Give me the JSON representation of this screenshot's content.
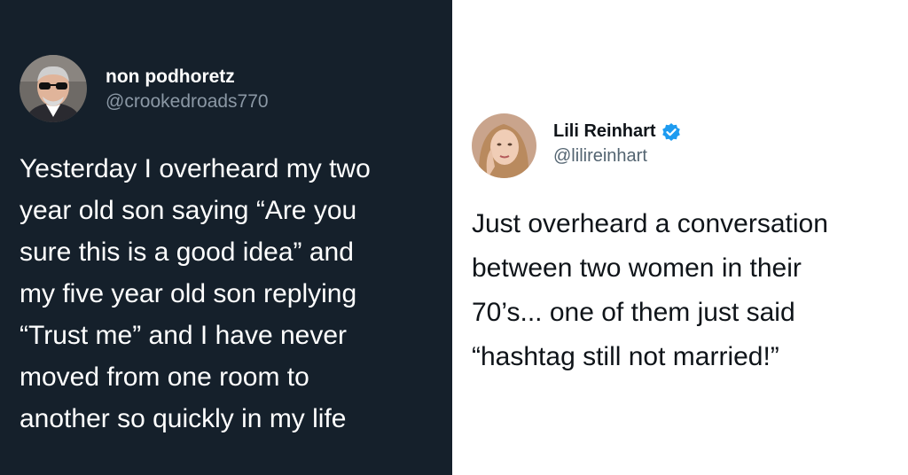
{
  "left_tweet": {
    "display_name": "non podhoretz",
    "handle": "@crookedroads770",
    "avatar_icon": "profile-photo-man-sunglasses",
    "text": "Yesterday I overheard my two\nyear old son saying “Are you\nsure this is a good idea” and\nmy five year old son replying\n“Trust me” and I have never\nmoved from one room to\nanother so quickly in my life",
    "theme": {
      "background": "#15202b",
      "text": "#ffffff",
      "muted": "#8b98a5"
    }
  },
  "right_tweet": {
    "display_name": "Lili Reinhart",
    "handle": "@lilireinhart",
    "avatar_icon": "profile-photo-woman",
    "verified_icon": "verified-badge-icon",
    "text": "Just overheard a conversation\nbetween two women in their\n70’s... one of them just said\n“hashtag still not married!”",
    "theme": {
      "background": "#ffffff",
      "text": "#0f1419",
      "muted": "#536471",
      "verified": "#1d9bf0"
    }
  }
}
